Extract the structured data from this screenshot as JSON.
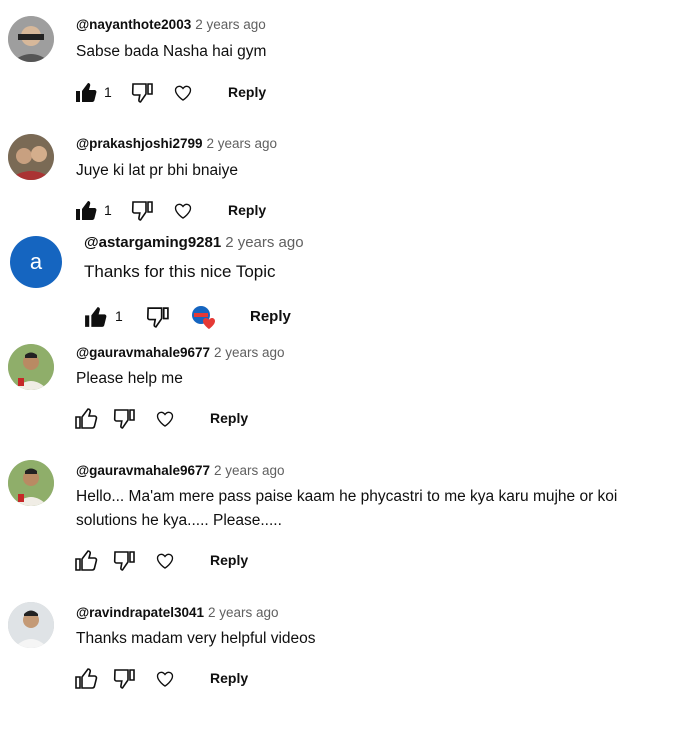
{
  "comments": [
    {
      "handle": "@nayanthote2003",
      "time": "2 years ago",
      "text": "Sabse bada Nasha hai gym",
      "likes": "1",
      "reply_label": "Reply"
    },
    {
      "handle": "@prakashjoshi2799",
      "time": "2 years ago",
      "text": "Juye ki lat pr bhi bnaiye",
      "likes": "1",
      "reply_label": "Reply"
    },
    {
      "handle": "@astargaming9281",
      "time": "2 years ago",
      "text": "Thanks for this nice Topic",
      "likes": "1",
      "reply_label": "Reply",
      "avatar_letter": "a"
    },
    {
      "handle": "@gauravmahale9677",
      "time": "2 years ago",
      "text": "Please help me",
      "reply_label": "Reply"
    },
    {
      "handle": "@gauravmahale9677",
      "time": "2 years ago",
      "text_line1": "Hello... Ma'am mere pass paise kaam he phycastri to me kya karu mujhe or koi",
      "text_line2": "solutions he kya..... Please.....",
      "reply_label": "Reply"
    },
    {
      "handle": "@ravindrapatel3041",
      "time": "2 years ago",
      "text": "Thanks madam very helpful videos",
      "reply_label": "Reply"
    }
  ],
  "icons": {
    "like": "thumb-up-icon",
    "dislike": "thumb-down-icon",
    "heart": "heart-icon",
    "creator_heart": "creator-heart-icon"
  },
  "colors": {
    "accent": "#1565c0",
    "heart": "#e53935",
    "muted": "#606060"
  }
}
